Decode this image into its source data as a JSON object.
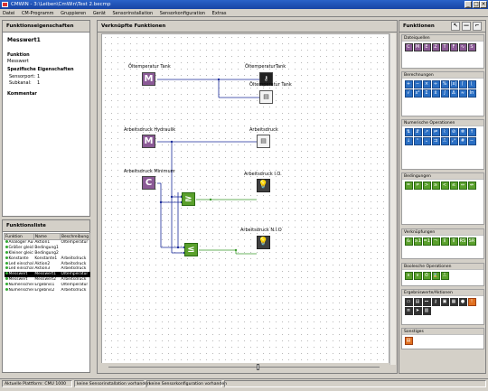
{
  "window": {
    "title": "CMWIN - 3:\\Leiben\\CmWin\\Test 2.becmp"
  },
  "menu": [
    "Datei",
    "CM-Programm",
    "Gruppieren",
    "Gerät",
    "Sensorinstallation",
    "Sensorkonfiguration",
    "Extras"
  ],
  "props": {
    "header": "Funktionseigenschaften",
    "name": "Messwert1",
    "function_heading": "Funktion",
    "function_value": "Messwert",
    "specific_heading": "Spezifische Eigenschaften",
    "sensor_label": "Sensorport:",
    "sensor_value": "1",
    "subkanal_label": "Subkanal:",
    "subkanal_value": "1",
    "comment_heading": "Kommentar"
  },
  "flist": {
    "header": "Funktionsliste",
    "columns": [
      "Funktion",
      "Name",
      "Beschreibung"
    ],
    "rows": [
      {
        "f": "Analoger Ausgang",
        "n": "Aktion1",
        "b": "Öltemperatur",
        "sel": false
      },
      {
        "f": "Größer gleich",
        "n": "Bedingung1",
        "b": "",
        "sel": false
      },
      {
        "f": "Kleiner gleich",
        "n": "Bedingung2",
        "b": "",
        "sel": false
      },
      {
        "f": "Konstante",
        "n": "Konstante1",
        "b": "Arbeitsdruck",
        "sel": false
      },
      {
        "f": "Led einschalten",
        "n": "Aktion2",
        "b": "Arbeitsdruck",
        "sel": false
      },
      {
        "f": "Led einschalten",
        "n": "Aktion3",
        "b": "Arbeitsdruck",
        "sel": false
      },
      {
        "f": "Messwert",
        "n": "Messwert1",
        "b": "Öltemperatur",
        "sel": true
      },
      {
        "f": "Messwert",
        "n": "Messwert2",
        "b": "Arbeitsdruck",
        "sel": false
      },
      {
        "f": "Numerischer Ausg",
        "n": "Ergebnis1",
        "b": "Öltemperatur",
        "sel": false
      },
      {
        "f": "Numerischer Ausg",
        "n": "Ergebnis2",
        "b": "Arbeitsdruck",
        "sel": false
      }
    ]
  },
  "canvas": {
    "header": "Verknüpfte Funktionen",
    "nodes": {
      "oel_tank": "Öltemperatur Tank",
      "oel_tank_key": "ÖltemperaturTank",
      "oel_tank_doc": "Öltemperatur Tank",
      "ad_hydraulik": "Arbeitsdruck Hydraulik",
      "ad_doc": "Arbeitsdruck",
      "ad_minimum": "Arbeitsdruck Minimum",
      "ad_io": "Arbeitsdruck I.O.",
      "ad_nio": "Arbeitsdruck N.I.O"
    }
  },
  "funcs": {
    "header": "Funktionen",
    "groups": [
      "Dateiquellen",
      "Berechnungen",
      "Numerische Operationen",
      "Bedingungen",
      "Verknüpfungen",
      "Boolesche Operationen",
      "Ergebniswerte/Aktionen",
      "Sonstiges"
    ]
  },
  "status": {
    "platform": "Aktuelle Plattform: CMU 1000",
    "sensor_inst": "keine Sensorinstallation vorhanden",
    "sensor_conf": "keine Sensorkonfiguration vorhanden"
  }
}
